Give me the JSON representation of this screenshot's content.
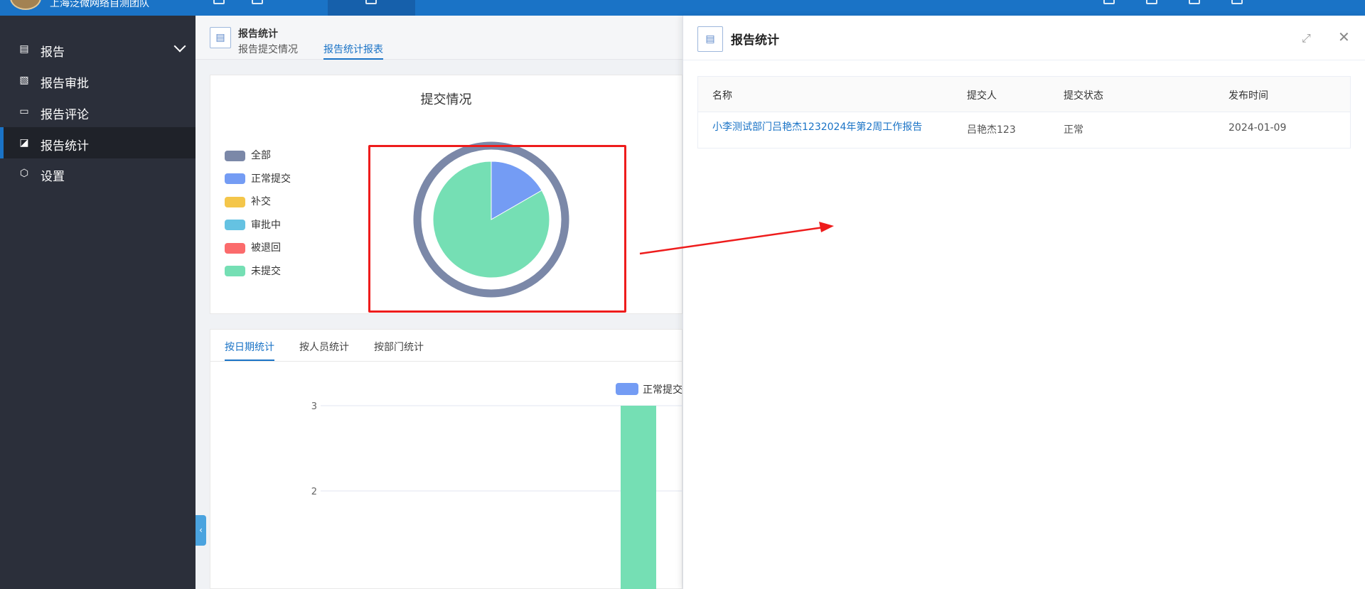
{
  "topbar": {
    "org_name": "上海泛微网络自测团队"
  },
  "sidebar": {
    "items": [
      {
        "label": "报告",
        "icon": "document-icon"
      },
      {
        "label": "报告审批",
        "icon": "approval-icon"
      },
      {
        "label": "报告评论",
        "icon": "comment-icon"
      },
      {
        "label": "报告统计",
        "icon": "statistics-icon"
      },
      {
        "label": "设置",
        "icon": "settings-icon"
      }
    ],
    "active_index": 3
  },
  "main_header": {
    "title": "报告统计",
    "tabs": [
      {
        "label": "报告提交情况"
      },
      {
        "label": "报告统计报表"
      }
    ],
    "active_tab": 1
  },
  "pie_card": {
    "chart_data": {
      "type": "pie",
      "title": "提交情况",
      "legend_placement": "left",
      "series": [
        {
          "name": "全部",
          "color": "#7b88a8"
        },
        {
          "name": "正常提交",
          "color": "#749cf4"
        },
        {
          "name": "补交",
          "color": "#f4c64a"
        },
        {
          "name": "审批中",
          "color": "#65c2e2"
        },
        {
          "name": "被退回",
          "color": "#fb6b6c"
        },
        {
          "name": "未提交",
          "color": "#75dfb4"
        }
      ],
      "slices": [
        {
          "name": "正常提交",
          "value": 1,
          "color": "#749cf4"
        },
        {
          "name": "未提交",
          "value": 5,
          "color": "#75dfb4"
        }
      ],
      "outer_ring": {
        "name": "全部",
        "value": 6,
        "color": "#7b88a8"
      }
    }
  },
  "bar_card": {
    "tabs": [
      {
        "label": "按日期统计"
      },
      {
        "label": "按人员统计"
      },
      {
        "label": "按部门统计"
      }
    ],
    "active_tab": 0,
    "chart_data": {
      "type": "bar",
      "legend": [
        {
          "name": "正常提交",
          "color": "#749cf4"
        }
      ],
      "y_ticks": [
        3,
        2
      ],
      "ylim": [
        0,
        3
      ],
      "bars": [
        {
          "value": 3,
          "color": "#75dfb4"
        }
      ],
      "grid": true
    }
  },
  "panel": {
    "title": "报告统计",
    "columns": [
      "名称",
      "提交人",
      "提交状态",
      "发布时间"
    ],
    "rows": [
      {
        "name": "小李测试部门吕艳杰1232024年第2周工作报告",
        "submitter": "吕艳杰123",
        "status": "正常",
        "date": "2024-01-09"
      }
    ]
  },
  "colors": {
    "primary": "#1a73c6",
    "sidebar_bg": "#2b2f3a",
    "annotation": "#ee1c1c"
  }
}
